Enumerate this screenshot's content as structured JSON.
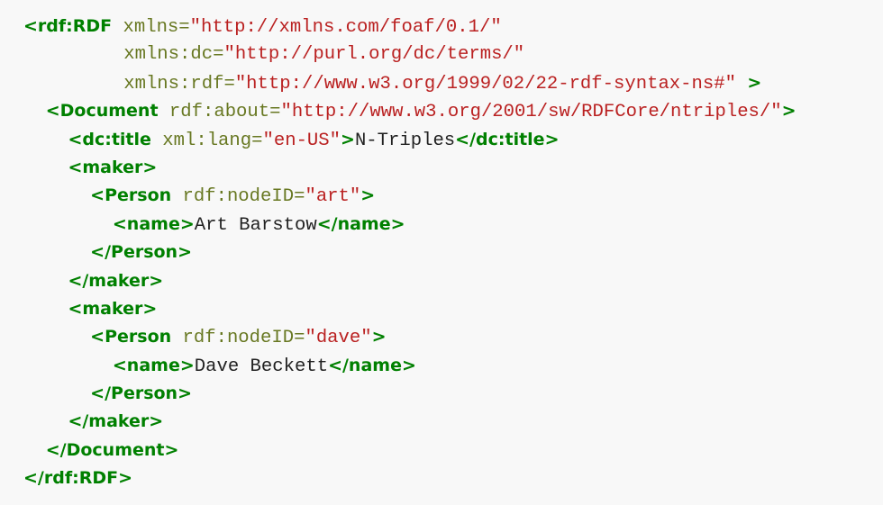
{
  "code": {
    "lines": [
      {
        "indent": "",
        "parts": [
          {
            "t": "tag",
            "v": "<rdf:RDF"
          },
          {
            "t": "text",
            "v": " "
          },
          {
            "t": "attr",
            "v": "xmlns="
          },
          {
            "t": "val",
            "v": "\"http://xmlns.com/foaf/0.1/\""
          }
        ]
      },
      {
        "indent": "         ",
        "parts": [
          {
            "t": "attr",
            "v": "xmlns:dc="
          },
          {
            "t": "val",
            "v": "\"http://purl.org/dc/terms/\""
          }
        ]
      },
      {
        "indent": "         ",
        "parts": [
          {
            "t": "attr",
            "v": "xmlns:rdf="
          },
          {
            "t": "val",
            "v": "\"http://www.w3.org/1999/02/22-rdf-syntax-ns#\""
          },
          {
            "t": "text",
            "v": " "
          },
          {
            "t": "tag",
            "v": ">"
          }
        ]
      },
      {
        "indent": "  ",
        "parts": [
          {
            "t": "tag",
            "v": "<Document"
          },
          {
            "t": "text",
            "v": " "
          },
          {
            "t": "attr",
            "v": "rdf:about="
          },
          {
            "t": "val",
            "v": "\"http://www.w3.org/2001/sw/RDFCore/ntriples/\""
          },
          {
            "t": "tag",
            "v": ">"
          }
        ]
      },
      {
        "indent": "    ",
        "parts": [
          {
            "t": "tag",
            "v": "<dc:title"
          },
          {
            "t": "text",
            "v": " "
          },
          {
            "t": "attr",
            "v": "xml:lang="
          },
          {
            "t": "val",
            "v": "\"en-US\""
          },
          {
            "t": "tag",
            "v": ">"
          },
          {
            "t": "text",
            "v": "N-Triples"
          },
          {
            "t": "tag",
            "v": "</dc:title>"
          }
        ]
      },
      {
        "indent": "    ",
        "parts": [
          {
            "t": "tag",
            "v": "<maker>"
          }
        ]
      },
      {
        "indent": "      ",
        "parts": [
          {
            "t": "tag",
            "v": "<Person"
          },
          {
            "t": "text",
            "v": " "
          },
          {
            "t": "attr",
            "v": "rdf:nodeID="
          },
          {
            "t": "val",
            "v": "\"art\""
          },
          {
            "t": "tag",
            "v": ">"
          }
        ]
      },
      {
        "indent": "        ",
        "parts": [
          {
            "t": "tag",
            "v": "<name>"
          },
          {
            "t": "text",
            "v": "Art Barstow"
          },
          {
            "t": "tag",
            "v": "</name>"
          }
        ]
      },
      {
        "indent": "      ",
        "parts": [
          {
            "t": "tag",
            "v": "</Person>"
          }
        ]
      },
      {
        "indent": "    ",
        "parts": [
          {
            "t": "tag",
            "v": "</maker>"
          }
        ]
      },
      {
        "indent": "    ",
        "parts": [
          {
            "t": "tag",
            "v": "<maker>"
          }
        ]
      },
      {
        "indent": "      ",
        "parts": [
          {
            "t": "tag",
            "v": "<Person"
          },
          {
            "t": "text",
            "v": " "
          },
          {
            "t": "attr",
            "v": "rdf:nodeID="
          },
          {
            "t": "val",
            "v": "\"dave\""
          },
          {
            "t": "tag",
            "v": ">"
          }
        ]
      },
      {
        "indent": "        ",
        "parts": [
          {
            "t": "tag",
            "v": "<name>"
          },
          {
            "t": "text",
            "v": "Dave Beckett"
          },
          {
            "t": "tag",
            "v": "</name>"
          }
        ]
      },
      {
        "indent": "      ",
        "parts": [
          {
            "t": "tag",
            "v": "</Person>"
          }
        ]
      },
      {
        "indent": "    ",
        "parts": [
          {
            "t": "tag",
            "v": "</maker>"
          }
        ]
      },
      {
        "indent": "  ",
        "parts": [
          {
            "t": "tag",
            "v": "</Document>"
          }
        ]
      },
      {
        "indent": "",
        "parts": [
          {
            "t": "tag",
            "v": "</rdf:RDF>"
          }
        ]
      }
    ]
  },
  "colors": {
    "background": "#f8f8f8",
    "tag": "#008000",
    "attribute": "#687822",
    "value": "#ba2121",
    "text": "#222222"
  }
}
